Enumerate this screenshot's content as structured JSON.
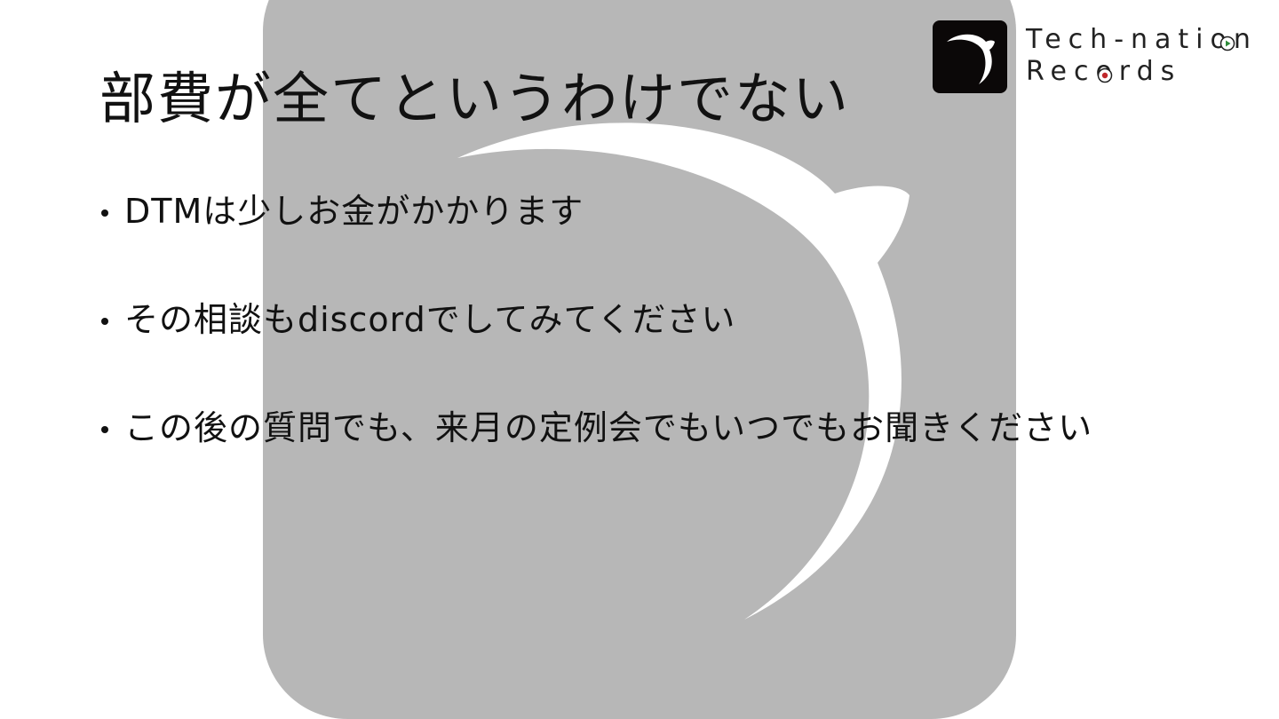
{
  "slide": {
    "title": "部費が全てというわけでない",
    "bullets": [
      "DTMは少しお金がかかります",
      "その相談もdiscordでしてみてください",
      "この後の質問でも、来月の定例会でもいつでもお聞きください"
    ]
  },
  "logo": {
    "line1": "Tech-nation",
    "line2": "Records",
    "tile_color": "#0b0808",
    "accent_green": "#2e8b3a",
    "accent_red": "#c0282c"
  },
  "background_mark": {
    "tile_color": "#b7b7b7",
    "crescent_color": "#ffffff"
  }
}
